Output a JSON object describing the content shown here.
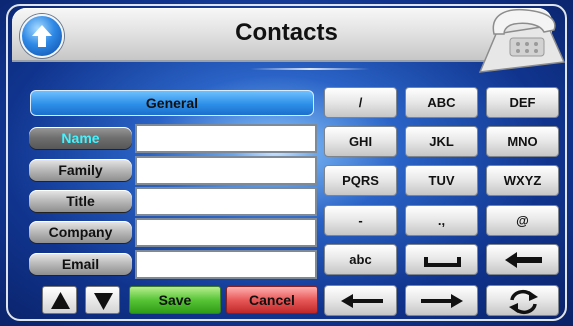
{
  "header": {
    "title": "Contacts",
    "up_icon": "up-arrow-icon",
    "corner_icon": "telephone-icon"
  },
  "form": {
    "section_label": "General",
    "fields": [
      {
        "label": "Name",
        "value": "",
        "active": true
      },
      {
        "label": "Family",
        "value": ""
      },
      {
        "label": "Title",
        "value": ""
      },
      {
        "label": "Company",
        "value": ""
      },
      {
        "label": "Email",
        "value": ""
      }
    ]
  },
  "keypad": {
    "row1": [
      "/",
      "ABC",
      "DEF"
    ],
    "row2": [
      "GHI",
      "JKL",
      "MNO"
    ],
    "row3": [
      "PQRS",
      "TUV",
      "WXYZ"
    ],
    "row4": [
      "-",
      ".,",
      "@"
    ],
    "row5": [
      "abc"
    ],
    "icons": {
      "space": "space-bar-icon",
      "backspace": "backspace-arrow-icon",
      "left": "left-arrow-icon",
      "right": "right-arrow-icon",
      "refresh": "refresh-icon"
    }
  },
  "bottom": {
    "save_label": "Save",
    "cancel_label": "Cancel",
    "up_icon": "triangle-up-icon",
    "down_icon": "triangle-down-icon"
  },
  "colors": {
    "background": "#1a47a8",
    "active_label": "#3ff3ff",
    "general_bar": "#2d8fe8",
    "save": "#57c436",
    "cancel": "#e85858"
  }
}
